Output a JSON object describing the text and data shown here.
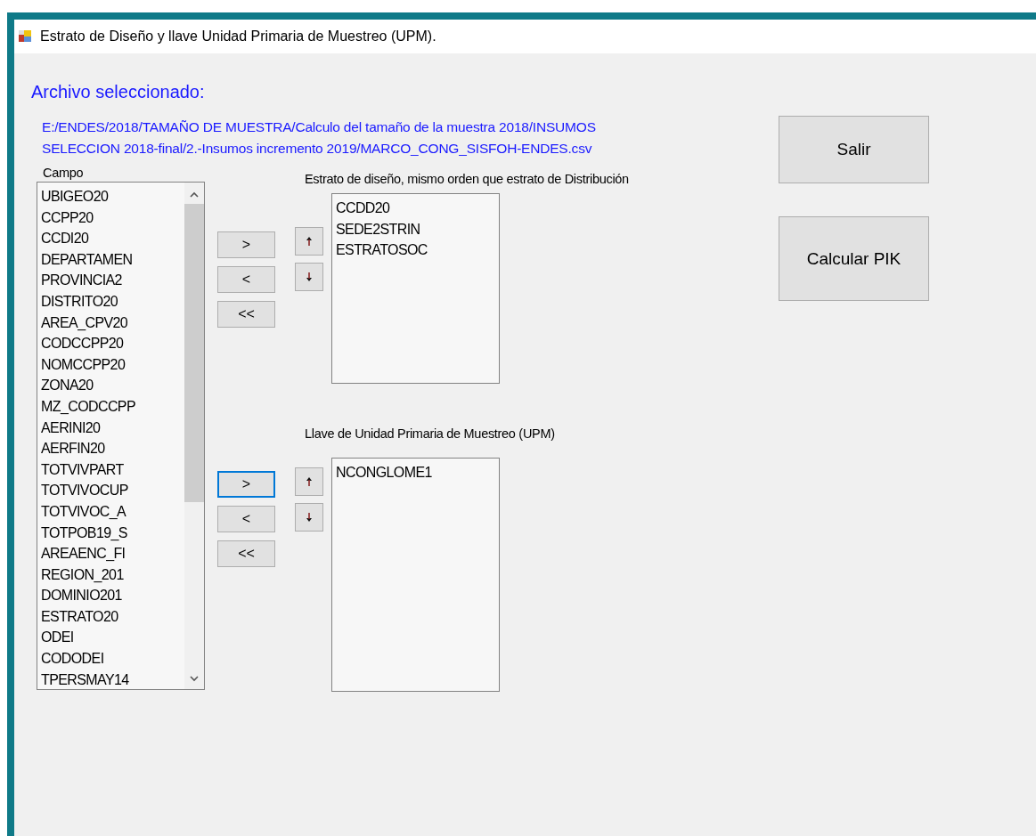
{
  "window": {
    "title": "Estrato de Diseño y llave Unidad Primaria de Muestreo (UPM)."
  },
  "file": {
    "label": "Archivo seleccionado:",
    "path_lines": [
      "E:/ENDES/2018/TAMAÑO DE MUESTRA/Calculo del tamaño de la muestra 2018/INSUMOS",
      "SELECCION 2018-final/2.-Insumos incremento 2019/MARCO_CONG_SISFOH-ENDES.csv"
    ]
  },
  "fields": {
    "label": "Campo",
    "items": [
      "UBIGEO20",
      "CCPP20",
      "CCDI20",
      "DEPARTAMEN",
      "PROVINCIA2",
      "DISTRITO20",
      "AREA_CPV20",
      "CODCCPP20",
      "NOMCCPP20",
      "ZONA20",
      "MZ_CODCCPP",
      "AERINI20",
      "AERFIN20",
      "TOTVIVPART",
      "TOTVIVOCUP",
      "TOTVIVOC_A",
      "TOTPOB19_S",
      "AREAENC_FI",
      "REGION_201",
      "DOMINIO201",
      "ESTRATO20",
      "ODEI",
      "CODODEI",
      "TPERSMAY14"
    ]
  },
  "sections": [
    {
      "label": "Estrato de diseño, mismo orden que estrato de Distribución",
      "items": [
        "CCDD20",
        "SEDE2STRIN",
        "ESTRATOSOC"
      ],
      "transfer_buttons": [
        {
          "label": ">",
          "focused": false
        },
        {
          "label": "<",
          "focused": false
        },
        {
          "label": "<<",
          "focused": false
        }
      ]
    },
    {
      "label": "Llave de Unidad Primaria de Muestreo (UPM)",
      "items": [
        "NCONGLOME1"
      ],
      "transfer_buttons": [
        {
          "label": ">",
          "focused": true
        },
        {
          "label": "<",
          "focused": false
        },
        {
          "label": "<<",
          "focused": false
        }
      ]
    }
  ],
  "actions": [
    {
      "label": "Salir"
    },
    {
      "label": "Calcular PIK"
    }
  ]
}
